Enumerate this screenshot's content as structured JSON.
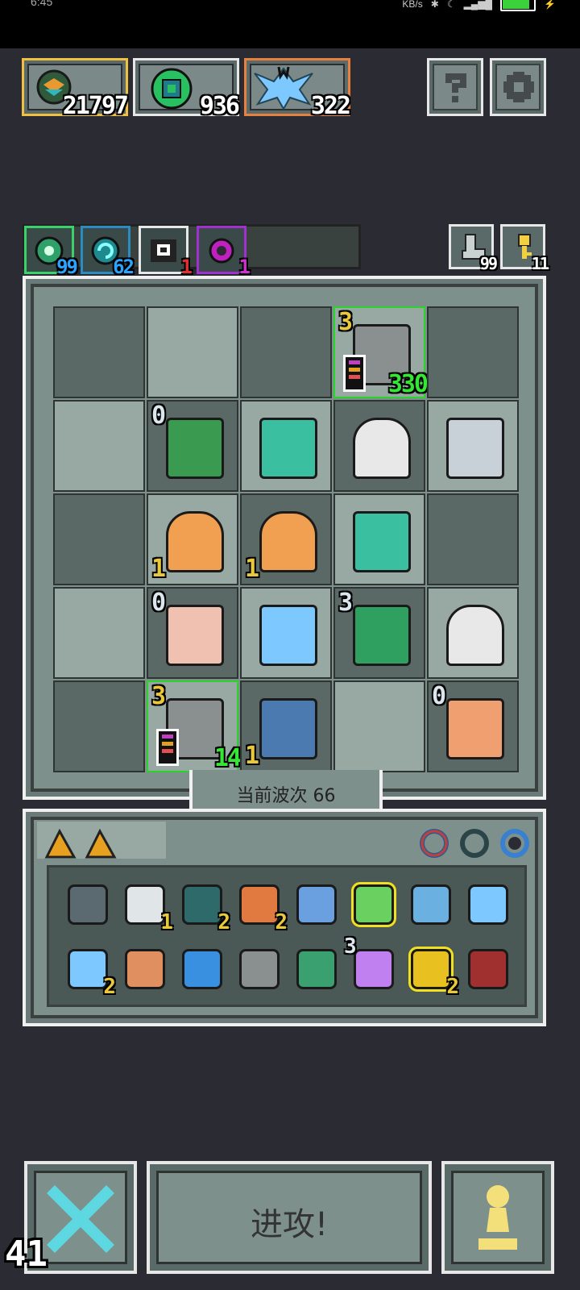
{
  "status_bar": {
    "time": "6:45",
    "net_speed": "KB/s"
  },
  "currencies": [
    {
      "name": "coin-icon",
      "value": "21797",
      "accent": "#f0c040"
    },
    {
      "name": "green-gem-icon",
      "value": "936",
      "accent": "#e7e7e7"
    },
    {
      "name": "crystal-icon",
      "value": "322",
      "accent": "#e88040"
    }
  ],
  "resources": [
    {
      "name": "green-orb-icon",
      "value": "99",
      "color": "#2aa4ff"
    },
    {
      "name": "teal-spiral-icon",
      "value": "62",
      "color": "#2aa4ff"
    },
    {
      "name": "white-skull-icon",
      "value": "1",
      "color": "#e23030"
    },
    {
      "name": "purple-ring-icon",
      "value": "1",
      "color": "#d030d0"
    }
  ],
  "side_counters": [
    {
      "name": "boot-icon",
      "value": "99"
    },
    {
      "name": "key-icon",
      "value": "11"
    }
  ],
  "board": {
    "wave_label": "当前波次 66",
    "cells": [
      {
        "row": 0,
        "col": 3,
        "unit": "robot-tower",
        "level": "3",
        "hp": "330"
      },
      {
        "row": 1,
        "col": 1,
        "unit": "green-monster",
        "level": "0"
      },
      {
        "row": 1,
        "col": 2,
        "unit": "teal-beetle"
      },
      {
        "row": 1,
        "col": 3,
        "unit": "skull-knight"
      },
      {
        "row": 1,
        "col": 4,
        "unit": "dragon"
      },
      {
        "row": 2,
        "col": 1,
        "unit": "golden-idol",
        "level": "1"
      },
      {
        "row": 2,
        "col": 2,
        "unit": "golden-idol",
        "level": "1"
      },
      {
        "row": 2,
        "col": 3,
        "unit": "teal-beetle"
      },
      {
        "row": 3,
        "col": 1,
        "unit": "wizard",
        "level": "0"
      },
      {
        "row": 3,
        "col": 2,
        "unit": "crystal-moth"
      },
      {
        "row": 3,
        "col": 3,
        "unit": "green-eye",
        "level": "3"
      },
      {
        "row": 3,
        "col": 4,
        "unit": "skull-knight"
      },
      {
        "row": 4,
        "col": 1,
        "unit": "robot-tower",
        "level": "3",
        "hp": "14"
      },
      {
        "row": 4,
        "col": 2,
        "unit": "ice-dragon",
        "level": "1"
      },
      {
        "row": 4,
        "col": 4,
        "unit": "miner",
        "level": "0"
      }
    ]
  },
  "inventory": {
    "tabs": [
      "cheese-icon",
      "cheese-icon"
    ],
    "rings": [
      "red-ring-icon",
      "teal-ring-icon",
      "blue-ring-icon"
    ],
    "items": [
      {
        "name": "chip-icon",
        "count": ""
      },
      {
        "name": "scroll-icon",
        "count": "1"
      },
      {
        "name": "heart-gem-icon",
        "count": "2"
      },
      {
        "name": "fox-icon",
        "count": "2"
      },
      {
        "name": "potion-icon",
        "count": ""
      },
      {
        "name": "flask-icon",
        "count": ""
      },
      {
        "name": "crystal-shard-icon",
        "count": ""
      },
      {
        "name": "ice-bird-icon",
        "count": ""
      },
      {
        "name": "ice-claw-icon",
        "count": "2"
      },
      {
        "name": "bullet-icon",
        "count": ""
      },
      {
        "name": "gear-icon",
        "count": ""
      },
      {
        "name": "rock-icon",
        "count": ""
      },
      {
        "name": "butterfly-orb-icon",
        "count": ""
      },
      {
        "name": "star-sparkle-icon",
        "count": "3"
      },
      {
        "name": "gold-chain-icon",
        "count": "2"
      },
      {
        "name": "shield-icon",
        "count": ""
      }
    ]
  },
  "actions": {
    "attack_label": "进攻!",
    "fps": "41"
  }
}
